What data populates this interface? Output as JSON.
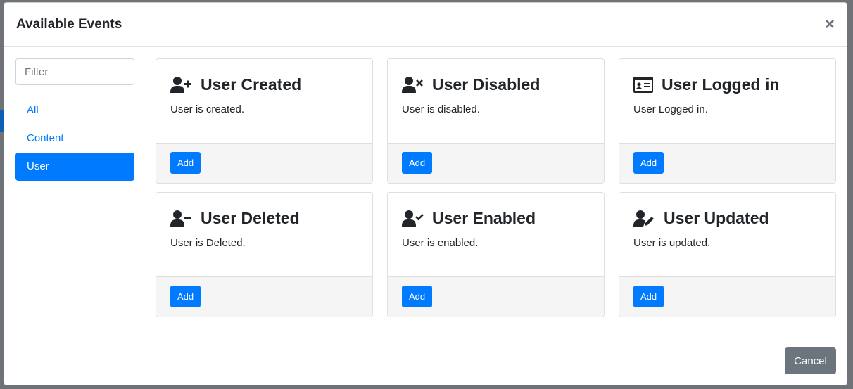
{
  "modal": {
    "title": "Available Events",
    "close_symbol": "×"
  },
  "filter": {
    "placeholder": "Filter"
  },
  "nav": [
    {
      "label": "All",
      "active": false
    },
    {
      "label": "Content",
      "active": false
    },
    {
      "label": "User",
      "active": true
    }
  ],
  "events": [
    {
      "icon": "user-plus-icon",
      "title": "User Created",
      "description": "User is created.",
      "button": "Add"
    },
    {
      "icon": "user-times-icon",
      "title": "User Disabled",
      "description": "User is disabled.",
      "button": "Add"
    },
    {
      "icon": "id-card-icon",
      "title": "User Logged in",
      "description": "User Logged in.",
      "button": "Add"
    },
    {
      "icon": "user-minus-icon",
      "title": "User Deleted",
      "description": "User is Deleted.",
      "button": "Add"
    },
    {
      "icon": "user-check-icon",
      "title": "User Enabled",
      "description": "User is enabled.",
      "button": "Add"
    },
    {
      "icon": "user-edit-icon",
      "title": "User Updated",
      "description": "User is updated.",
      "button": "Add"
    }
  ],
  "footer": {
    "cancel_label": "Cancel"
  },
  "colors": {
    "primary": "#007bff",
    "secondary": "#6c757d"
  }
}
